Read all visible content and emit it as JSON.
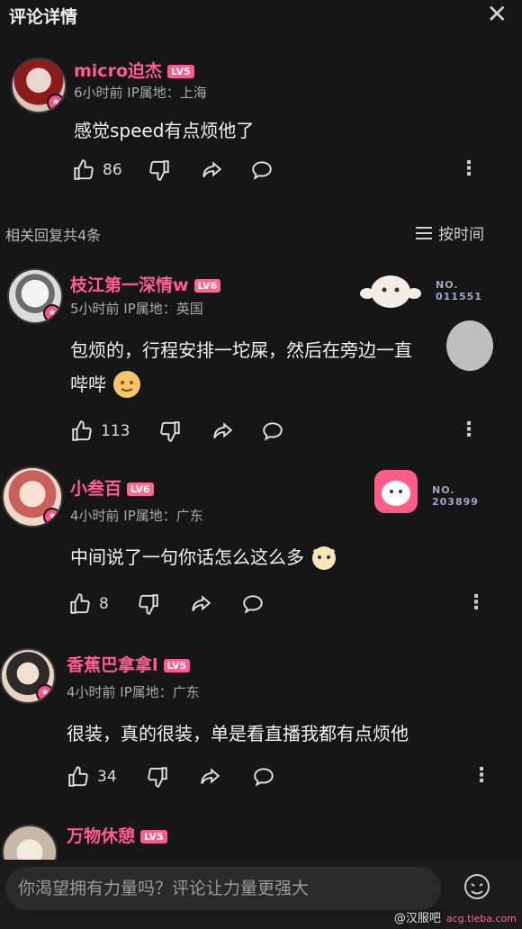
{
  "header": {
    "title": "评论详情",
    "close": "✕"
  },
  "main_comment": {
    "name": "micro迫杰",
    "level": "LV5",
    "meta": "6小时前 IP属地：上海",
    "text": "感觉speed有点烦他了",
    "likes": "86"
  },
  "replies_bar": {
    "count": "相关回复共4条",
    "sort": "按时间"
  },
  "replies": [
    {
      "name": "枝江第一深情w",
      "level": "LV6",
      "meta": "5小时前 IP属地：英国",
      "text1": "包烦的，行程安排一坨屎，然后在旁边一直",
      "text2": "哔哔",
      "likes": "113",
      "card_no": "NO.",
      "card_num": "011551"
    },
    {
      "name": "小叁百",
      "level": "LV6",
      "meta": "4小时前 IP属地：广东",
      "text1": "中间说了一句你话怎么这么多",
      "likes": "8",
      "card_no": "NO.",
      "card_num": "203899"
    },
    {
      "name": "香蕉巴拿拿l",
      "level": "LV5",
      "meta": "4小时前 IP属地：广东",
      "text1": "很装，真的很装，单是看直播我都有点烦他",
      "likes": "34"
    },
    {
      "name": "万物休憩",
      "level": "LV5"
    }
  ],
  "input": {
    "placeholder": "你渴望拥有力量吗？评论让力量更强大"
  },
  "watermark": {
    "text": "@汉服吧",
    "domain": "acg.tieba.com"
  },
  "colors": {
    "accent": "#ff5c93",
    "background": "#161616"
  }
}
